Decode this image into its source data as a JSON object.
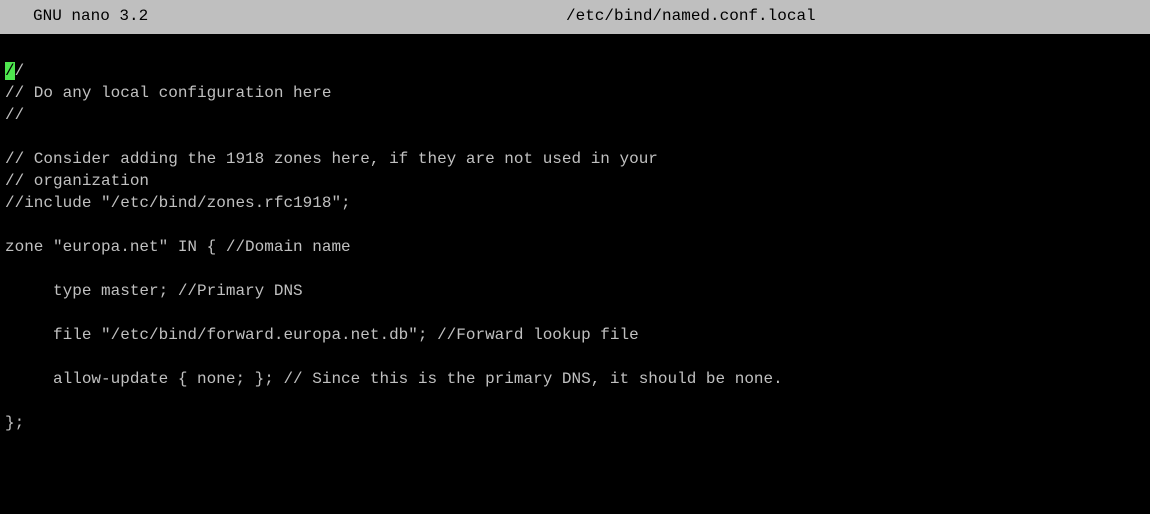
{
  "titlebar": {
    "app": "GNU nano 3.2",
    "file": "/etc/bind/named.conf.local"
  },
  "editor": {
    "cursor_char": "/",
    "first_line_rest": "/",
    "lines": [
      "// Do any local configuration here",
      "//",
      "",
      "// Consider adding the 1918 zones here, if they are not used in your",
      "// organization",
      "//include \"/etc/bind/zones.rfc1918\";",
      "",
      "zone \"europa.net\" IN { //Domain name",
      "",
      "     type master; //Primary DNS",
      "",
      "     file \"/etc/bind/forward.europa.net.db\"; //Forward lookup file",
      "",
      "     allow-update { none; }; // Since this is the primary DNS, it should be none.",
      "",
      "};"
    ]
  },
  "colors": {
    "terminal_bg": "#000000",
    "text": "#c0c0c0",
    "titlebar_bg": "#bfbfbf",
    "cursor_bg": "#4ee64e"
  }
}
